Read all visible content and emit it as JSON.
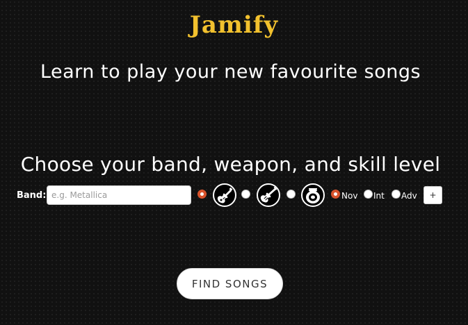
{
  "header": {
    "logo_text": "Jamify",
    "tagline": "Learn to play your new favourite songs"
  },
  "search": {
    "heading": "Choose your band, weapon, and skill level",
    "band_label": "Band:",
    "band_value": "",
    "band_placeholder": "e.g. Metallica"
  },
  "weapons": [
    {
      "icon": "electric-guitar-icon",
      "selected": true
    },
    {
      "icon": "bass-guitar-icon",
      "selected": false
    },
    {
      "icon": "drums-icon",
      "selected": false
    }
  ],
  "skills": [
    {
      "label": "Nov",
      "selected": true
    },
    {
      "label": "Int",
      "selected": false
    },
    {
      "label": "Adv",
      "selected": false
    }
  ],
  "add_button_label": "+",
  "find_button_label": "FIND SONGS",
  "colors": {
    "logo": "#f2c12e",
    "radio_selected": "#d9532c",
    "background": "#111111"
  }
}
